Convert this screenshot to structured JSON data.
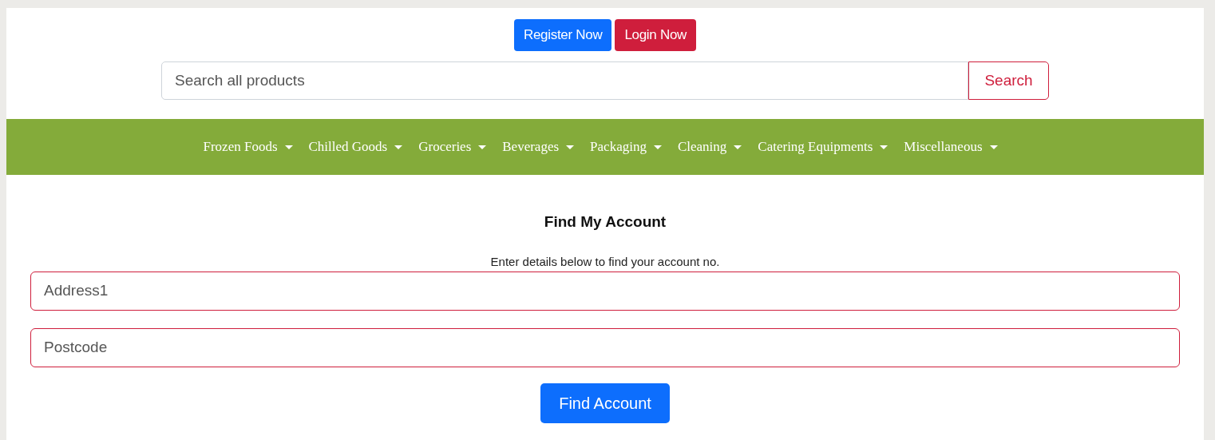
{
  "header_buttons": [
    {
      "label": "Register Now",
      "kind": "primary"
    },
    {
      "label": "Login Now",
      "kind": "danger"
    }
  ],
  "search": {
    "placeholder": "Search all products",
    "button": "Search"
  },
  "nav": [
    {
      "label": "Frozen Foods"
    },
    {
      "label": "Chilled Goods"
    },
    {
      "label": "Groceries"
    },
    {
      "label": "Beverages"
    },
    {
      "label": "Packaging"
    },
    {
      "label": "Cleaning"
    },
    {
      "label": "Catering Equipments"
    },
    {
      "label": "Miscellaneous"
    }
  ],
  "form": {
    "title": "Find My Account",
    "subtitle": "Enter details below to find your account no.",
    "fields": [
      {
        "placeholder": "Address1"
      },
      {
        "placeholder": "Postcode"
      }
    ],
    "submit": "Find Account"
  }
}
